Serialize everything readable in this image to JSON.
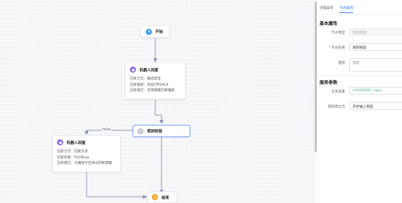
{
  "colors": {
    "start_icon": "#3b9cf5",
    "robot_icon": "#8a6cf0",
    "verify_icon": "#c8c9cc",
    "end_icon": "#f5a623",
    "edge": "#8a96b2",
    "accent": "#3370ff"
  },
  "canvas": {
    "nodes": {
      "start": {
        "title": "开始",
        "icon": "play-circle-icon"
      },
      "robot1": {
        "title": "机器人回复",
        "icon": "robot-icon",
        "lines": [
          {
            "label": "回复方式：",
            "value": "静态放音"
          },
          {
            "label": "回复模板：",
            "value": "欢迎3号0414"
          },
          {
            "label": "回复模式：",
            "value": "支持按键打断播放"
          }
        ]
      },
      "verify": {
        "title": "规则校验",
        "icon": "rule-check-icon"
      },
      "robot2": {
        "title": "机器人回复",
        "icon": "robot-icon",
        "lines": [
          {
            "label": "回复方式：",
            "value": "回复文本"
          },
          {
            "label": "回复变量：",
            "value": "FLOW.aa"
          },
          {
            "label": "回复模式：",
            "value": "只播放不支持识别和按键"
          }
        ]
      },
      "end": {
        "title": "结束",
        "icon": "stop-circle-icon"
      }
    },
    "edge_false_label": "false"
  },
  "panel": {
    "tabs": [
      "流程属性",
      "节点属性"
    ],
    "active_tab": 1,
    "basic_title": "基本属性",
    "node_type_label": "节点类型",
    "node_type_value": "规则校验",
    "node_name_label": "节点名称",
    "node_name_value": "规则校验",
    "desc_label": "描述",
    "desc_placeholder": "描述",
    "service_title": "服务参数",
    "text_var_label": "文本变量",
    "text_var_value": "SYSSSERIST.input",
    "rule_expr_label": "规则表达式",
    "rule_expr_value": "月份输入校验"
  }
}
